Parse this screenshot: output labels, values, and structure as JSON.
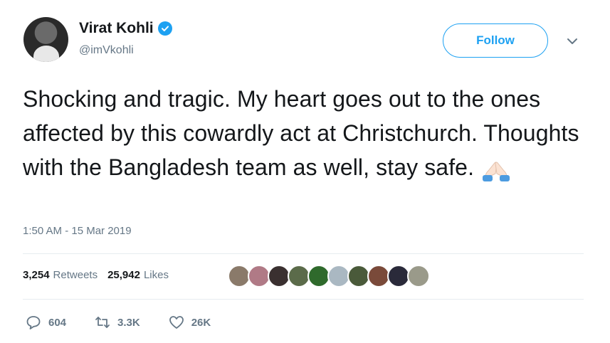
{
  "user": {
    "name": "Virat Kohli",
    "handle": "@imVkohli"
  },
  "follow_label": "Follow",
  "tweet": {
    "text": "Shocking and tragic. My heart goes out to the ones affected by this cowardly act at Christchurch. Thoughts with the Bangladesh team as well, stay safe.",
    "timestamp": "1:50 AM - 15 Mar 2019"
  },
  "stats": {
    "retweets_count": "3,254",
    "retweets_label": "Retweets",
    "likes_count": "25,942",
    "likes_label": "Likes"
  },
  "actions": {
    "replies": "604",
    "retweets": "3.3K",
    "likes": "26K"
  },
  "colors": {
    "accent": "#1da1f2",
    "muted": "#657786"
  },
  "icons": [
    "verified-badge-icon",
    "chevron-down-icon",
    "folded-hands-emoji",
    "reply-icon",
    "retweet-icon",
    "heart-icon"
  ]
}
